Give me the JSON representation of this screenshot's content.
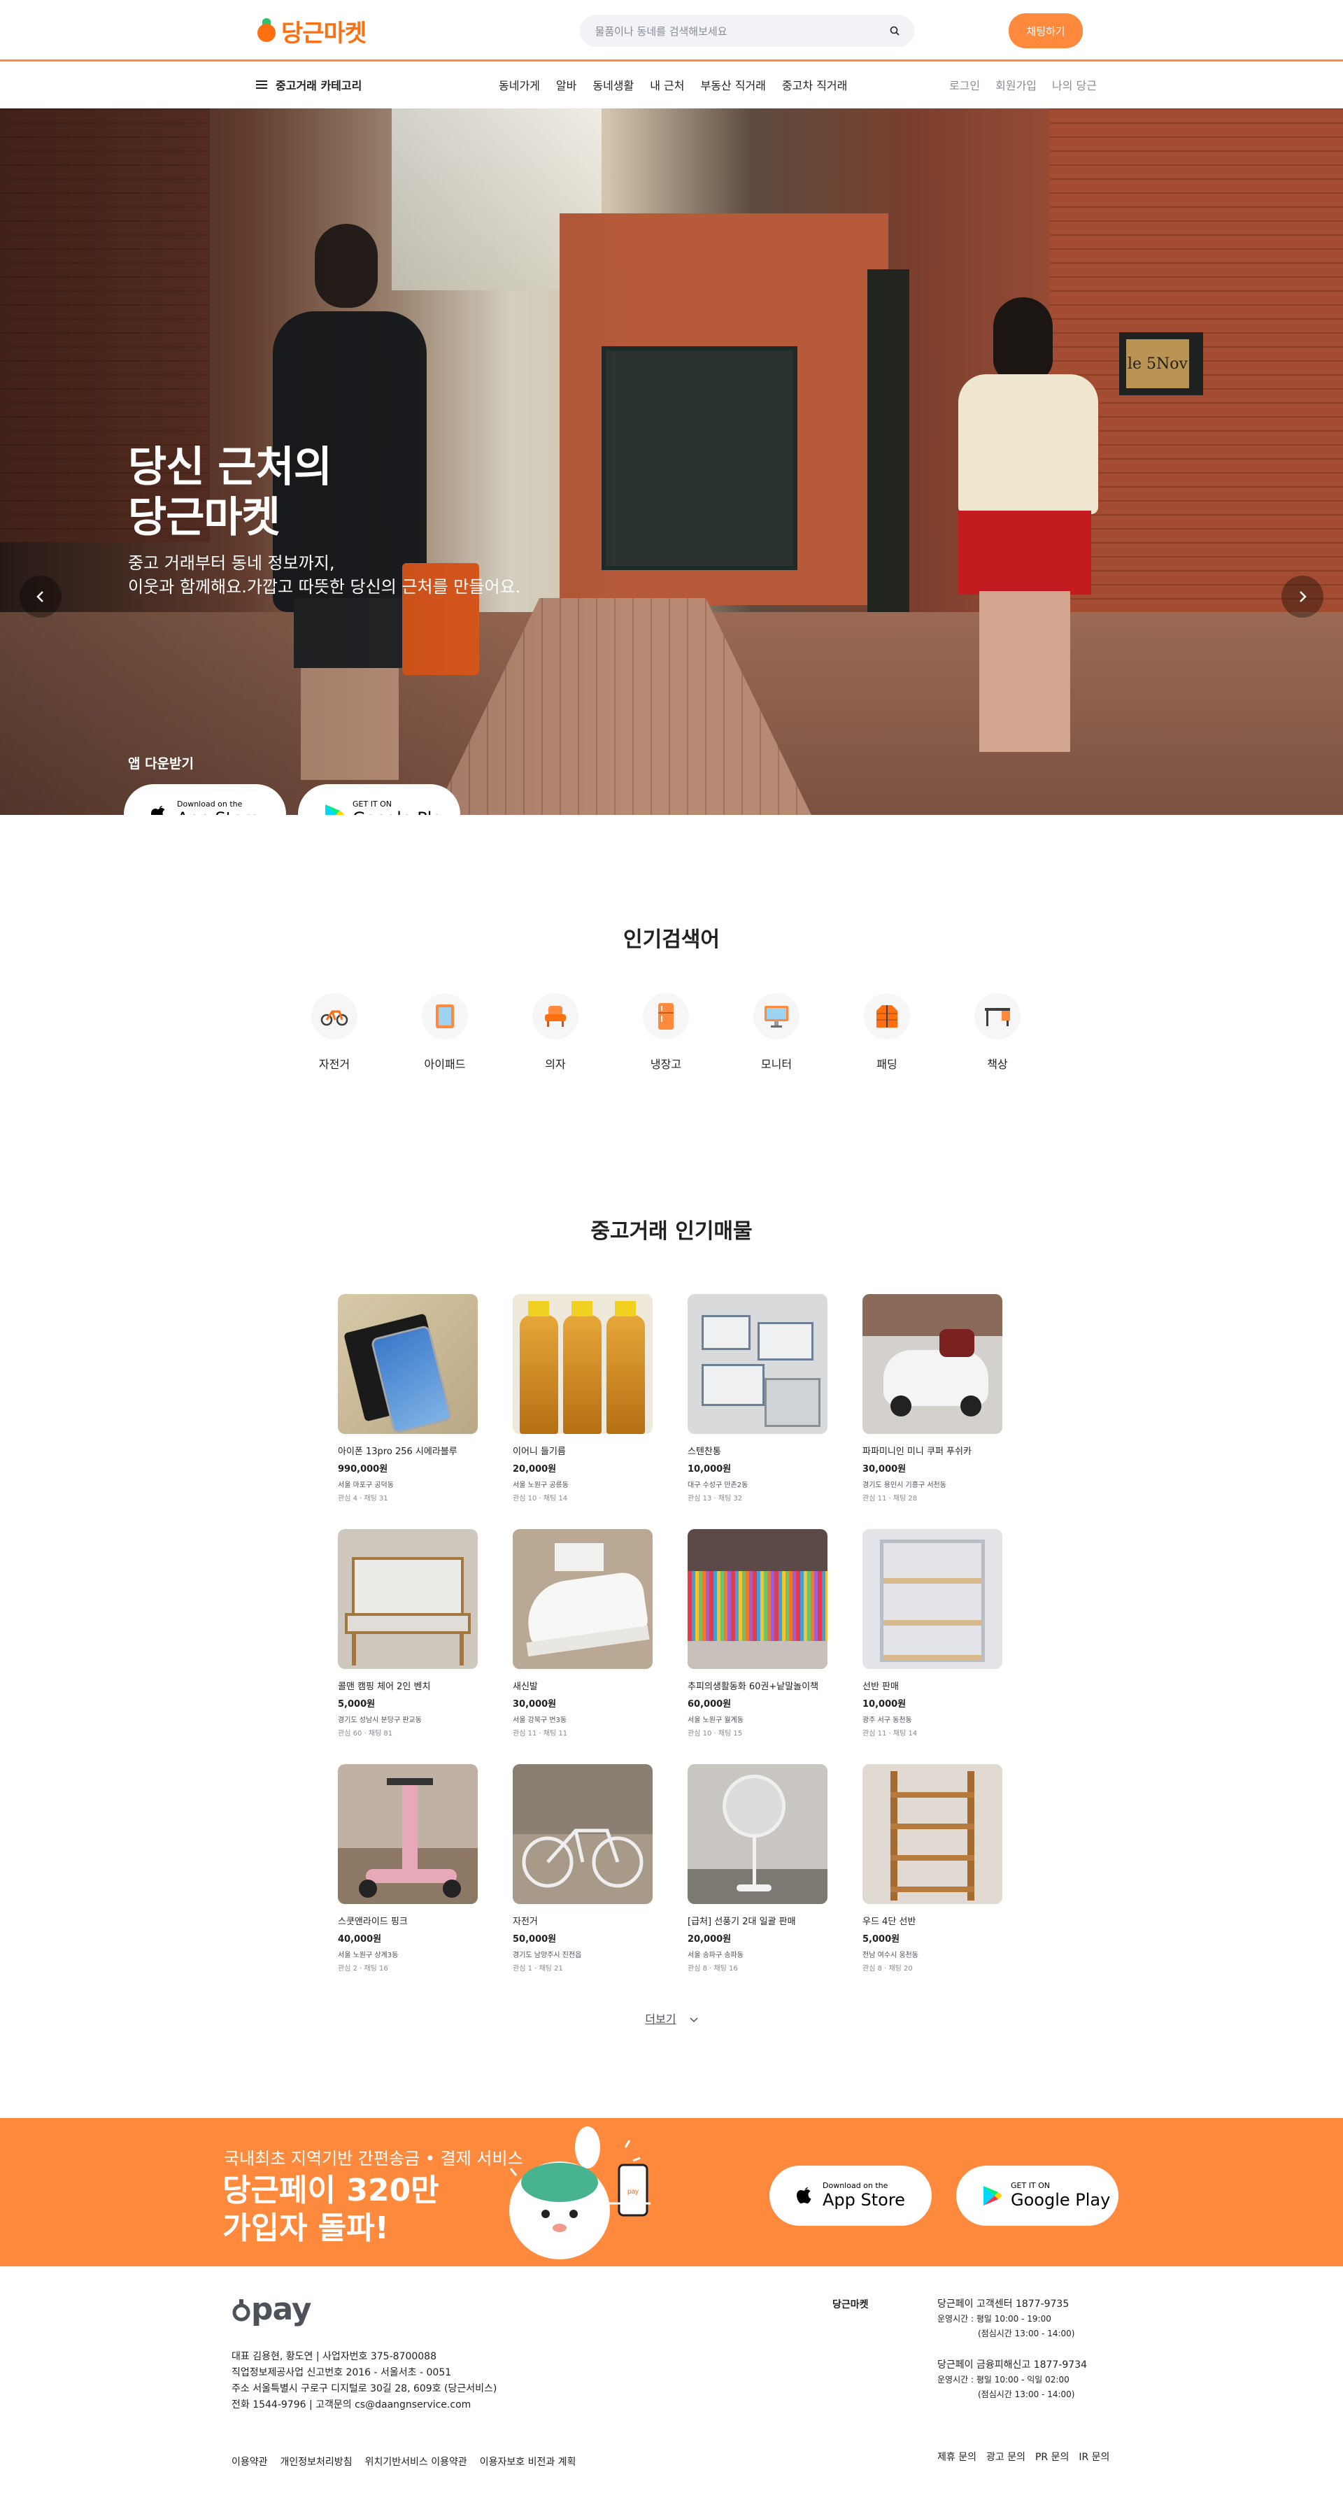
{
  "header": {
    "logo_text": "당근마켓",
    "search_placeholder": "물품이나 동네를 검색해보세요",
    "chat_button": "채팅하기"
  },
  "subnav": {
    "category": "중고거래 카테고리",
    "menu": [
      "동네가게",
      "알바",
      "동네생활",
      "내 근처",
      "부동산 직거래",
      "중고차 직거래"
    ],
    "user_menu": [
      "로그인",
      "회원가입",
      "나의 당근"
    ]
  },
  "hero": {
    "title_line1": "당신 근처의",
    "title_line2": "당근마켓",
    "desc_line1": "중고 거래부터 동네 정보까지,",
    "desc_line2": "이웃과 함께해요.가깝고 따뜻한 당신의 근처를 만들어요.",
    "download_label": "앱 다운받기",
    "sign_text": "le 5Nov",
    "appstore_small": "Download on the",
    "appstore_big": "App Store",
    "google_small": "GET IT ON",
    "google_big": "Google Play",
    "prev_icon": "chevron-left-icon",
    "next_icon": "chevron-right-icon",
    "slides_total": 4,
    "active_slide": 4
  },
  "popular": {
    "title": "인기검색어",
    "keywords": [
      {
        "label": "자전거",
        "icon": "bicycle-icon"
      },
      {
        "label": "아이패드",
        "icon": "tablet-icon"
      },
      {
        "label": "의자",
        "icon": "chair-icon"
      },
      {
        "label": "냉장고",
        "icon": "fridge-icon"
      },
      {
        "label": "모니터",
        "icon": "monitor-icon"
      },
      {
        "label": "패딩",
        "icon": "padded-jacket-icon"
      },
      {
        "label": "책상",
        "icon": "desk-icon"
      }
    ]
  },
  "products": {
    "title": "중고거래 인기매물",
    "items": [
      {
        "title": "아이폰 13pro 256 시에라블루",
        "price": "990,000원",
        "location": "서울 마포구 공덕동",
        "stats": "관심 4 · 채팅 31"
      },
      {
        "title": "이어니 들기름",
        "price": "20,000원",
        "location": "서울 노원구 공릉동",
        "stats": "관심 10 · 채팅 14"
      },
      {
        "title": "스텐찬통",
        "price": "10,000원",
        "location": "대구 수성구 만촌2동",
        "stats": "관심 13 · 채팅 32"
      },
      {
        "title": "파파미니인 미니 쿠퍼 푸쉬카",
        "price": "30,000원",
        "location": "경기도 용인시 기흥구 서천동",
        "stats": "관심 11 · 채팅 28"
      },
      {
        "title": "콜맨 캠핑 체어 2인 벤치",
        "price": "5,000원",
        "location": "경기도 성남시 분당구 판교동",
        "stats": "관심 60 · 채팅 81"
      },
      {
        "title": "새신발",
        "price": "30,000원",
        "location": "서울 강북구 번3동",
        "stats": "관심 11 · 채팅 11"
      },
      {
        "title": "추피의생활동화 60권+낱말놀이책",
        "price": "60,000원",
        "location": "서울 노원구 월계동",
        "stats": "관심 10 · 채팅 15"
      },
      {
        "title": "선반 판매",
        "price": "10,000원",
        "location": "광주 서구 동천동",
        "stats": "관심 11 · 채팅 14"
      },
      {
        "title": "스쿳앤라이드 핑크",
        "price": "40,000원",
        "location": "서울 노원구 상계3동",
        "stats": "관심 2 · 채팅 16"
      },
      {
        "title": "자전거",
        "price": "50,000원",
        "location": "경기도 남양주시 진전읍",
        "stats": "관심 1 · 채팅 21"
      },
      {
        "title": "[급처] 선풍기 2대 일괄 판매",
        "price": "20,000원",
        "location": "서울 송파구 송파동",
        "stats": "관심 8 · 채팅 16"
      },
      {
        "title": "우드 4단 선반",
        "price": "5,000원",
        "location": "전남 여수시 웅천동",
        "stats": "관심 8 · 채팅 20"
      }
    ],
    "more_label": "더보기"
  },
  "pay_banner": {
    "subtitle": "국내최초 지역기반 간편송금 • 결제 서비스",
    "title_line1": "당근페이 320만",
    "title_line2": "가입자 돌파!",
    "phone_label": "pay"
  },
  "footer": {
    "pay_logo": "pay",
    "company_lines": [
      "대표 김용현, 황도연    |    사업자번호 375-8700088",
      "직업정보제공사업 신고번호 2016 - 서울서초 - 0051",
      "주소 서울특별시 구로구 디지털로 30길 28, 609호 (당근서비스)",
      "전화 1544-9796    |    고객문의 cs@daangnservice.com"
    ],
    "brand": "당근마켓",
    "cs1_title": "당근페이 고객센터  1877-9735",
    "cs1_hours1": "운영시간 : 평일 10:00 - 19:00",
    "cs1_hours2": "(점심시간 13:00 - 14:00)",
    "cs2_title": "당근페이 금융피해신고  1877-9734",
    "cs2_hours1": "운영시간 : 평일 10:00 - 익일 02:00",
    "cs2_hours2": "(점심시간 13:00 - 14:00)",
    "links": [
      "이용약관",
      "개인정보처리방침",
      "위치기반서비스 이용약관",
      "이용자보호 비전과 계획"
    ],
    "links2": [
      "제휴 문의",
      "광고 문의",
      "PR 문의",
      "IR 문의"
    ]
  },
  "colors": {
    "brand_orange": "#ff6f0f",
    "accent_orange": "#ff8a3d",
    "text_dark": "#212124",
    "text_gray": "#868b94"
  }
}
